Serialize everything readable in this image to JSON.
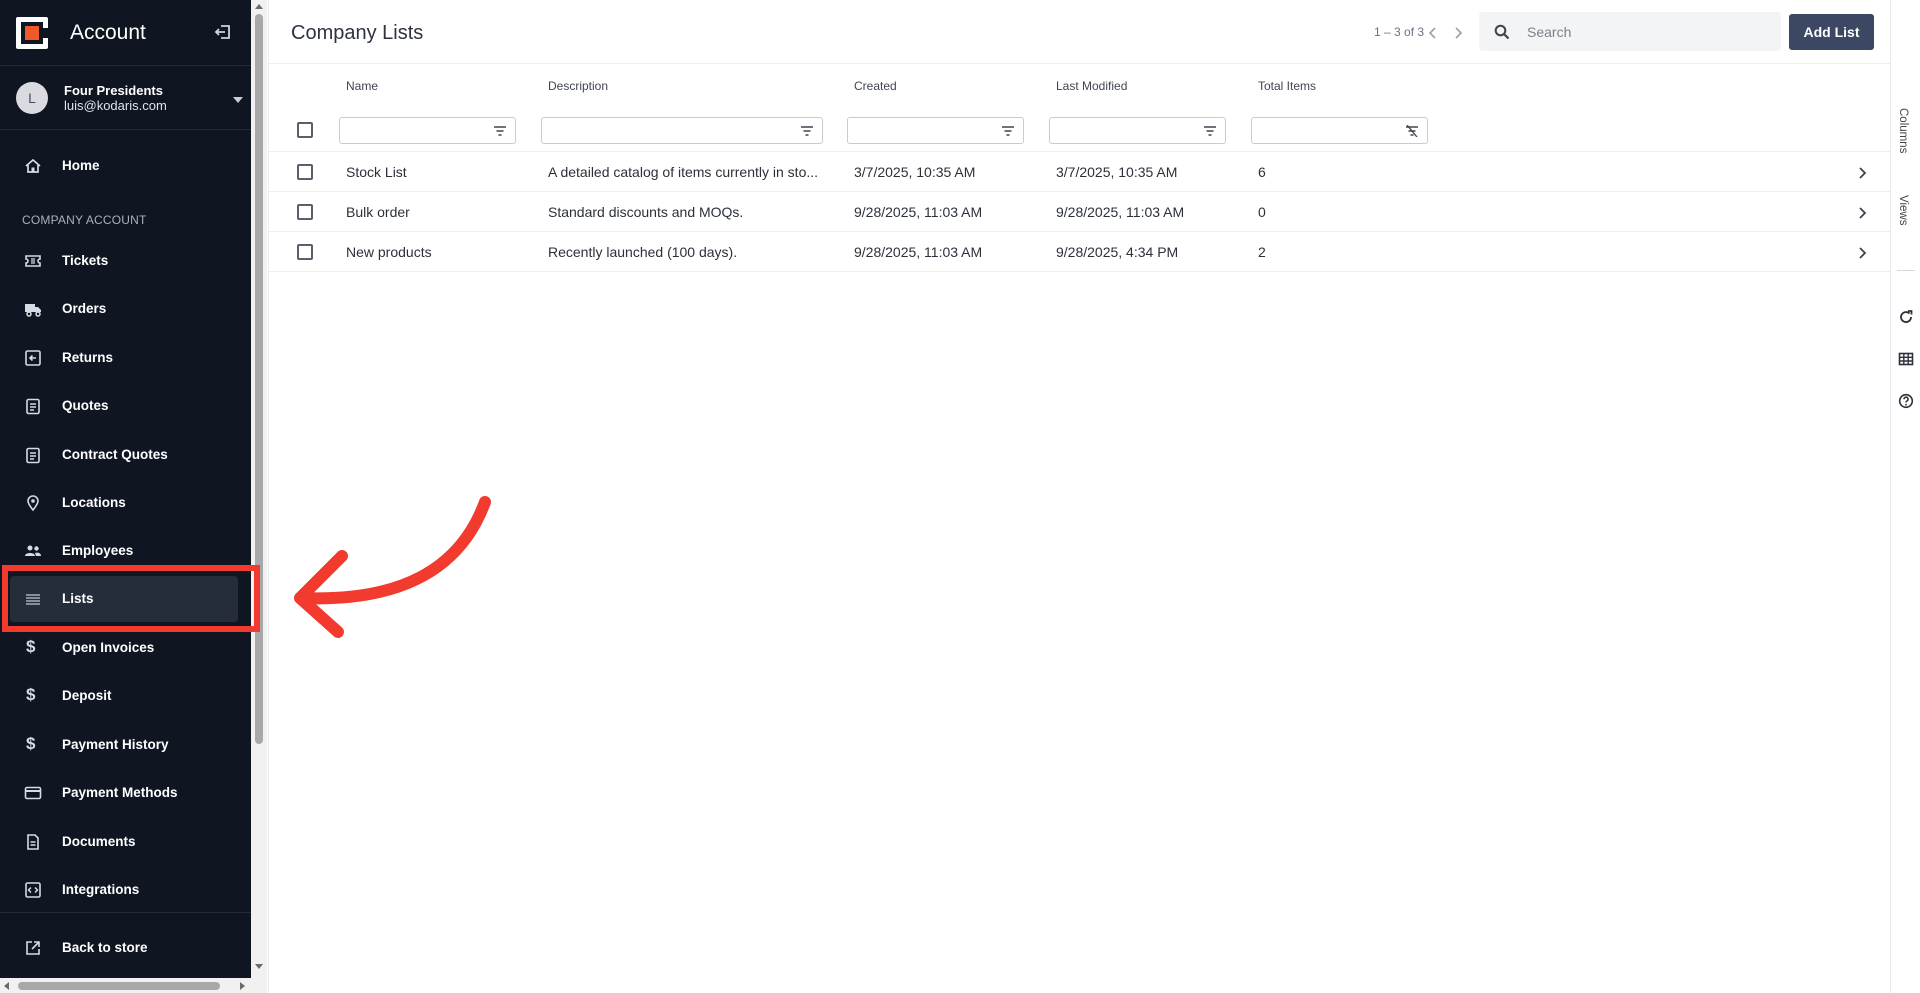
{
  "sidebar": {
    "title": "Account",
    "user": {
      "initial": "L",
      "name": "Four Presidents",
      "email": "luis@kodaris.com"
    },
    "home_label": "Home",
    "section_label": "COMPANY ACCOUNT",
    "items": [
      {
        "label": "Tickets",
        "icon": "ticket-icon"
      },
      {
        "label": "Orders",
        "icon": "truck-icon"
      },
      {
        "label": "Returns",
        "icon": "return-icon"
      },
      {
        "label": "Quotes",
        "icon": "clipboard-icon"
      },
      {
        "label": "Contract Quotes",
        "icon": "clipboard-icon"
      },
      {
        "label": "Locations",
        "icon": "pin-icon"
      },
      {
        "label": "Employees",
        "icon": "people-icon"
      },
      {
        "label": "Lists",
        "icon": "list-icon"
      },
      {
        "label": "Open Invoices",
        "icon": "dollar-icon"
      },
      {
        "label": "Deposit",
        "icon": "dollar-icon"
      },
      {
        "label": "Payment History",
        "icon": "dollar-icon"
      },
      {
        "label": "Payment Methods",
        "icon": "card-icon"
      },
      {
        "label": "Documents",
        "icon": "document-icon"
      },
      {
        "label": "Integrations",
        "icon": "code-icon"
      }
    ],
    "back_label": "Back to store",
    "active_item": "Lists"
  },
  "header": {
    "title": "Company Lists",
    "pagination": "1 – 3 of 3",
    "search_placeholder": "Search",
    "add_button": "Add List"
  },
  "table": {
    "columns": [
      "Name",
      "Description",
      "Created",
      "Last Modified",
      "Total Items"
    ],
    "rows": [
      {
        "name": "Stock List",
        "description": "A detailed catalog of items currently in sto...",
        "created": "3/7/2025, 10:35 AM",
        "modified": "3/7/2025, 10:35 AM",
        "total": "6"
      },
      {
        "name": "Bulk order",
        "description": "Standard discounts and MOQs.",
        "created": "9/28/2025, 11:03 AM",
        "modified": "9/28/2025, 11:03 AM",
        "total": "0"
      },
      {
        "name": "New products",
        "description": "Recently launched (100 days).",
        "created": "9/28/2025, 11:03 AM",
        "modified": "9/28/2025, 4:34 PM",
        "total": "2"
      }
    ]
  },
  "right_rail": {
    "columns_tab": "Columns",
    "views_tab": "Views"
  },
  "colors": {
    "sidebar_bg": "#0f1521",
    "accent_button": "#3b4763",
    "annotation_red": "#f23a2e",
    "logo_orange": "#f05a28"
  }
}
